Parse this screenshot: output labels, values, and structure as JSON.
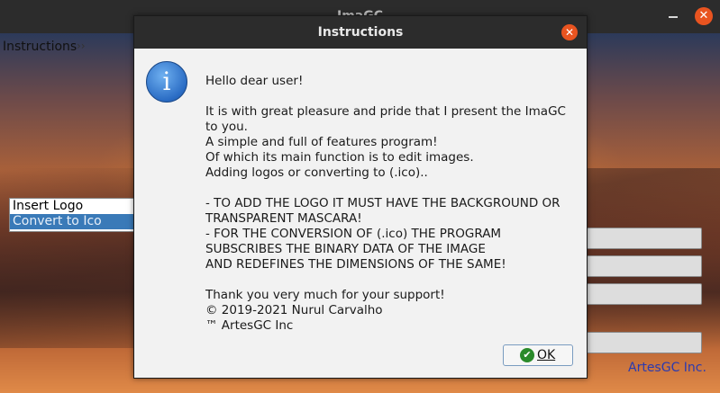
{
  "main_window": {
    "title": "ImaGC",
    "close_glyph": "✕"
  },
  "menu": {
    "instructions": "Instructions",
    "chevron": "››"
  },
  "options": [
    {
      "label": "Insert Logo"
    },
    {
      "label": "Convert to Ico"
    }
  ],
  "brand": "ArtesGC Inc.",
  "dialog": {
    "title": "Instructions",
    "close_glyph": "✕",
    "icon_glyph": "i",
    "lines": [
      "Hello dear user!",
      "",
      "It is with great pleasure and pride that I present the ImaGC",
      "to you.",
      "A simple and full of features program!",
      "Of which its main function is to edit images.",
      "Adding logos or converting to (.ico)..",
      "",
      "- TO ADD THE LOGO IT MUST HAVE THE BACKGROUND OR",
      "TRANSPARENT MASCARA!",
      "- FOR THE CONVERSION OF (.ico) THE PROGRAM",
      "SUBSCRIBES THE BINARY DATA OF THE IMAGE",
      "AND REDEFINES THE DIMENSIONS OF THE SAME!",
      "",
      "Thank you very much for your support!",
      "© 2019-2021 Nurul Carvalho",
      "™ ArtesGC Inc"
    ],
    "ok_label": "OK",
    "ok_check_glyph": "✔"
  },
  "colors": {
    "accent_close": "#e95420",
    "selection": "#3a7ab8",
    "brand_text": "#2a3ab0"
  }
}
